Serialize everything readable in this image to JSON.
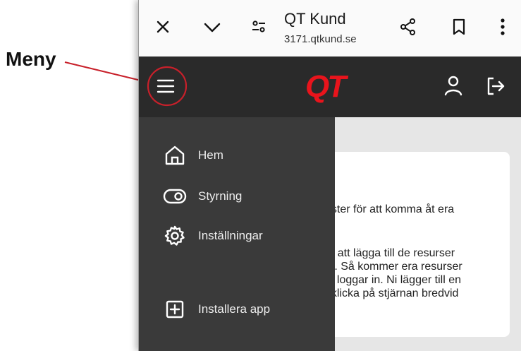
{
  "annotation": {
    "label": "Meny"
  },
  "browser": {
    "title": "QT Kund",
    "url": "3171.qtkund.se"
  },
  "app": {
    "logo": "QT"
  },
  "drawer": {
    "items": [
      {
        "label": "Hem",
        "icon": "home-icon"
      },
      {
        "label": "Styrning",
        "icon": "toggle-icon"
      },
      {
        "label": "Inställningar",
        "icon": "gear-icon"
      },
      {
        "label": "Installera app",
        "icon": "plus-square-icon"
      }
    ]
  },
  "card": {
    "line1": "nster för att komma åt era",
    "para2": [
      "m att lägga till de resurser",
      "er. Så kommer era resurser",
      "ni loggar in. Ni lägger till en",
      "t klicka på stjärnan bredvid"
    ]
  },
  "colors": {
    "accent": "#e8141c",
    "header_bg": "#2a2a2a",
    "drawer_bg": "#3a3a3a",
    "annotation": "#c8202a"
  }
}
